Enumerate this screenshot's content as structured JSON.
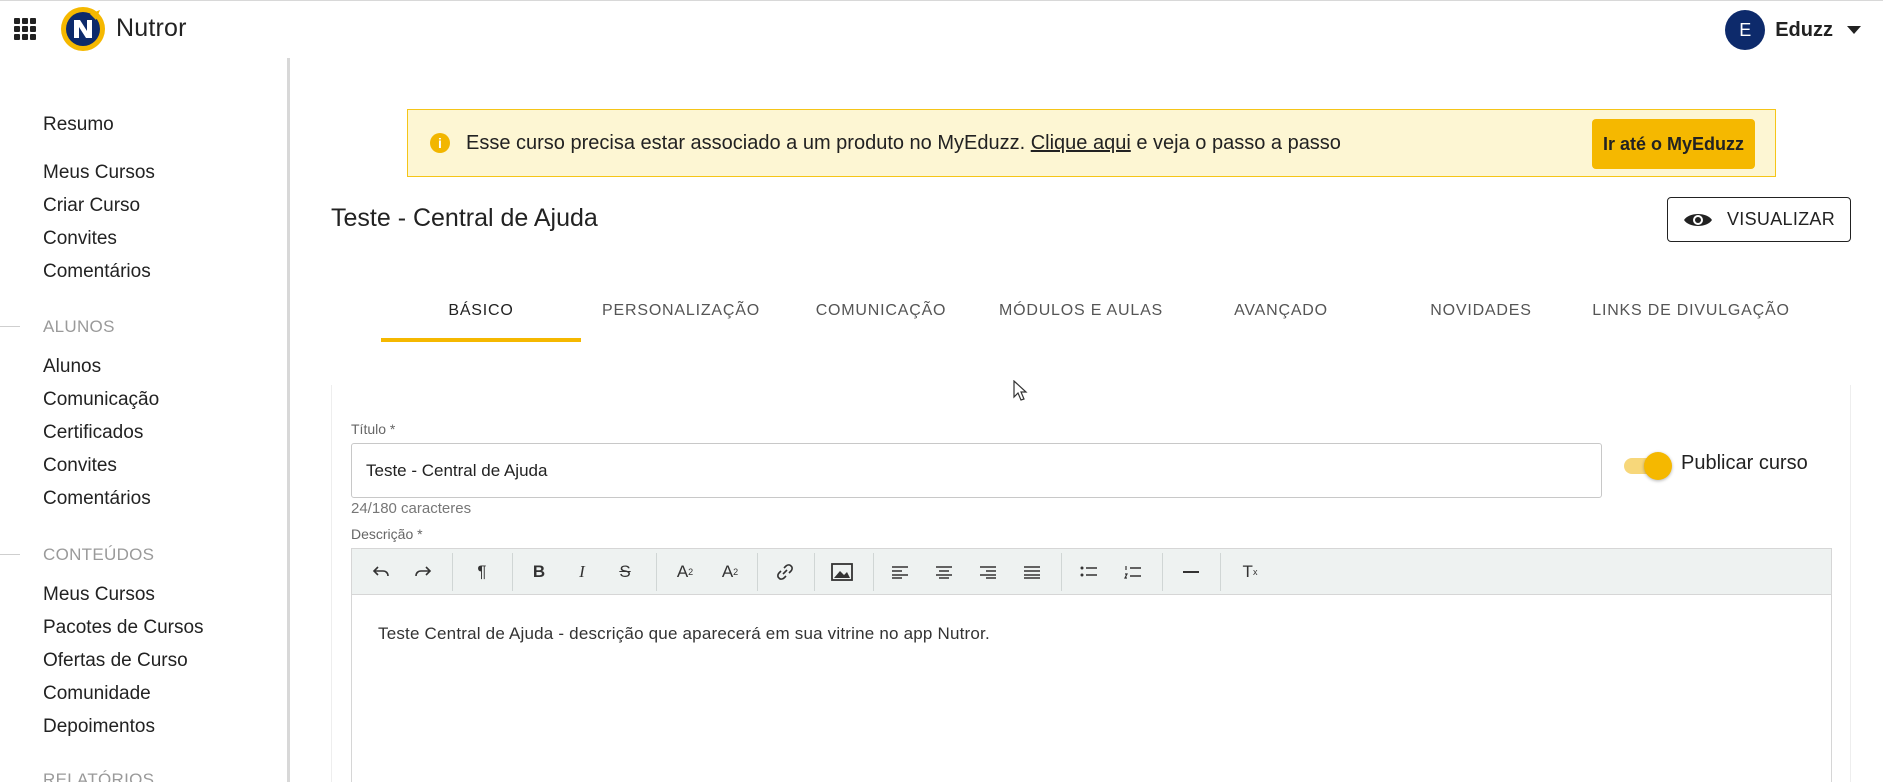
{
  "app": {
    "brand": "Nutror"
  },
  "account": {
    "initial": "E",
    "name": "Eduzz"
  },
  "sidebar": {
    "items": [
      {
        "label": "Resumo"
      },
      {
        "label": "Meus Cursos"
      },
      {
        "label": "Criar Curso"
      },
      {
        "label": "Convites"
      },
      {
        "label": "Comentários"
      }
    ],
    "sections": [
      {
        "title": "ALUNOS",
        "items": [
          {
            "label": "Alunos"
          },
          {
            "label": "Comunicação"
          },
          {
            "label": "Certificados"
          },
          {
            "label": "Convites"
          },
          {
            "label": "Comentários"
          }
        ]
      },
      {
        "title": "CONTEÚDOS",
        "items": [
          {
            "label": "Meus Cursos"
          },
          {
            "label": "Pacotes de Cursos"
          },
          {
            "label": "Ofertas de Curso"
          },
          {
            "label": "Comunidade"
          },
          {
            "label": "Depoimentos"
          }
        ]
      },
      {
        "title": "RELATÓRIOS",
        "items": []
      }
    ]
  },
  "alert": {
    "text_before": "Esse curso precisa estar associado a um produto no MyEduzz. ",
    "link": "Clique aqui",
    "text_after": " e veja o passo a passo",
    "button": "Ir até o MyEduzz",
    "color": "#f5b800"
  },
  "page": {
    "title": "Teste - Central de Ajuda",
    "view_button": "VISUALIZAR"
  },
  "tabs": [
    {
      "label": "BÁSICO",
      "active": true
    },
    {
      "label": "PERSONALIZAÇÃO"
    },
    {
      "label": "COMUNICAÇÃO"
    },
    {
      "label": "MÓDULOS E AULAS"
    },
    {
      "label": "AVANÇADO"
    },
    {
      "label": "NOVIDADES"
    },
    {
      "label": "LINKS DE DIVULGAÇÃO"
    }
  ],
  "form": {
    "title_label": "Título *",
    "title_value": "Teste - Central de Ajuda",
    "char_count": "24/180 caracteres",
    "publish_label": "Publicar curso",
    "publish_on": true,
    "description_label": "Descrição *",
    "description_text": "Teste Central de Ajuda - descrição que aparecerá em sua vitrine no app Nutror."
  },
  "editor_toolbar": [
    "undo-icon",
    "redo-icon",
    "paragraph-icon",
    "bold-icon",
    "italic-icon",
    "strikethrough-icon",
    "superscript-icon",
    "subscript-icon",
    "link-icon",
    "image-icon",
    "align-left-icon",
    "align-center-icon",
    "align-right-icon",
    "align-justify-icon",
    "bullet-list-icon",
    "numbered-list-icon",
    "horizontal-rule-icon",
    "clear-format-icon"
  ]
}
